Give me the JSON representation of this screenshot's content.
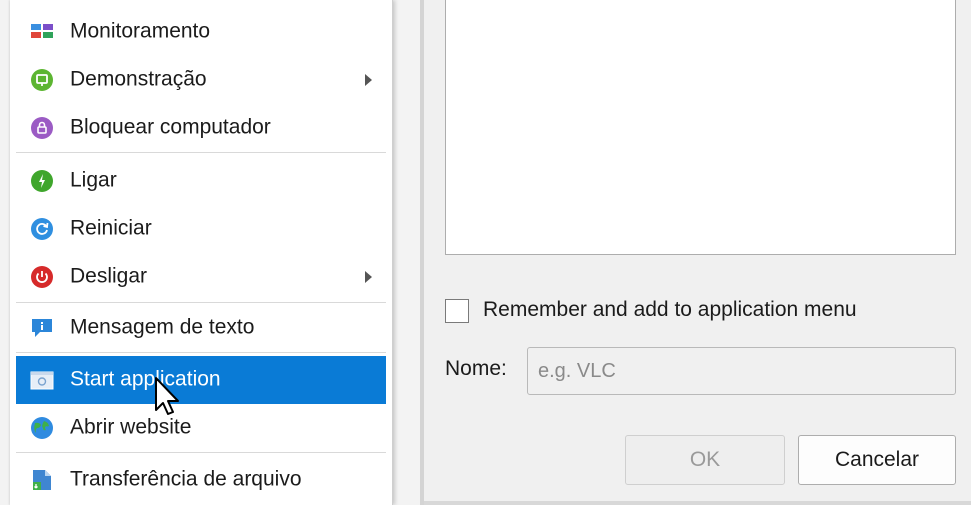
{
  "menu": {
    "items": [
      {
        "label": "Monitoramento",
        "icon": "monitor-tiles-icon"
      },
      {
        "label": "Demonstração",
        "icon": "demo-icon",
        "submenu": true
      },
      {
        "label": "Bloquear computador",
        "icon": "lock-icon"
      },
      {
        "label": "Ligar",
        "icon": "power-on-icon"
      },
      {
        "label": "Reiniciar",
        "icon": "restart-icon"
      },
      {
        "label": "Desligar",
        "icon": "power-off-icon",
        "submenu": true
      },
      {
        "label": "Mensagem de texto",
        "icon": "message-icon"
      },
      {
        "label": "Start application",
        "icon": "application-icon",
        "selected": true
      },
      {
        "label": "Abrir website",
        "icon": "globe-icon"
      },
      {
        "label": "Transferência de arquivo",
        "icon": "file-transfer-icon"
      }
    ]
  },
  "dialog": {
    "remember_label": "Remember and add to application menu",
    "remember_checked": false,
    "name_label": "Nome:",
    "name_placeholder": "e.g. VLC",
    "name_value": "",
    "ok_label": "OK",
    "cancel_label": "Cancelar"
  },
  "colors": {
    "selection": "#0a7bd6",
    "menu_background": "#ffffff",
    "dialog_background": "#f0f0f0"
  }
}
